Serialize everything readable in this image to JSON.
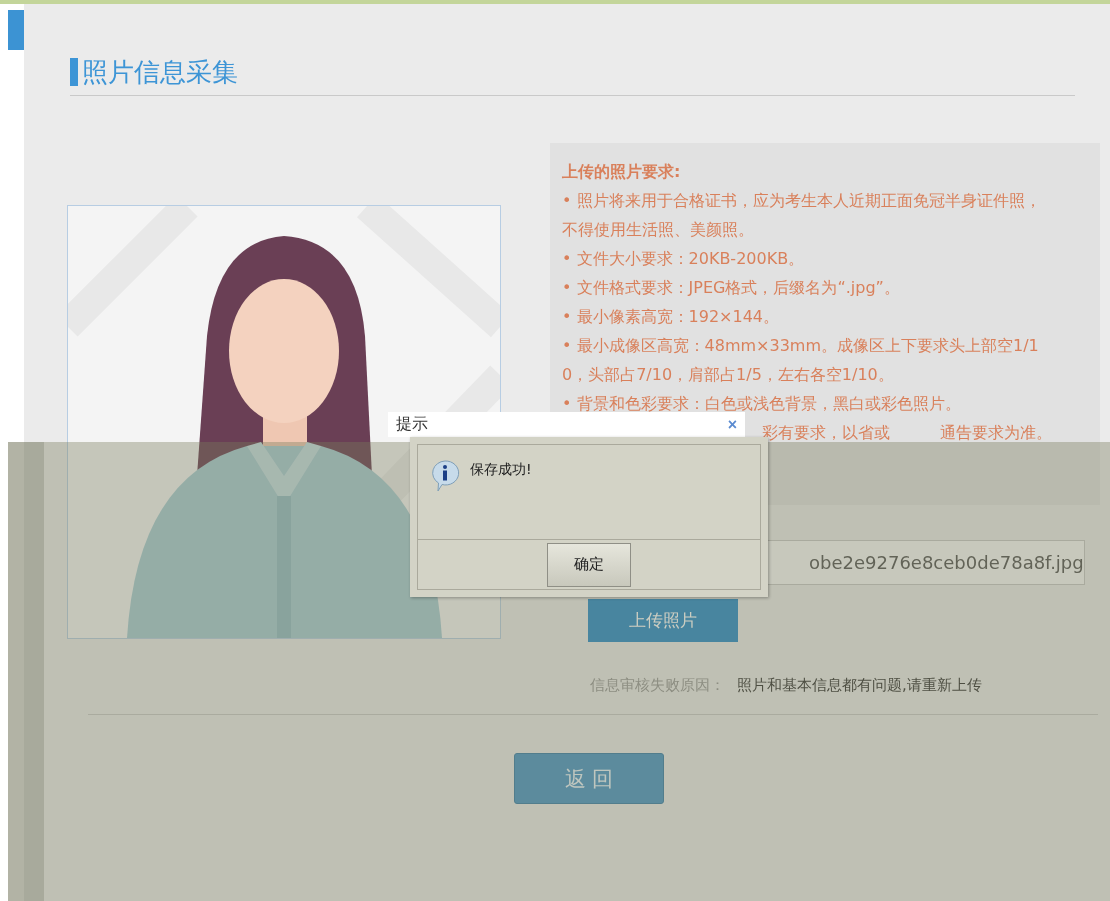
{
  "page": {
    "title": "照片信息采集"
  },
  "requirements": {
    "heading": "上传的照片要求:",
    "items": [
      "• 照片将来用于合格证书，应为考生本人近期正面免冠半身证件照，不得使用生活照、美颜照。",
      "• 文件大小要求：20KB-200KB。",
      "• 文件格式要求：JPEG格式，后缀名为“.jpg”。",
      "• 最小像素高宽：192×144。",
      "• 最小成像区高宽：48mm×33mm。成像区上下要求头上部空1/10，头部占7/10，肩部占1/5，左右各空1/10。",
      "• 背景和色彩要求：白色或浅色背景，黑白或彩色照片。"
    ],
    "partial_item": [
      "彩有要求，以省或",
      "通告要求为准。"
    ]
  },
  "file_field": {
    "value": "obe2e9276e8ceb0de78a8f.jpg"
  },
  "upload_button": "上传照片",
  "review": {
    "label": "信息审核失败原因：",
    "value": "照片和基本信息都有问题,请重新上传"
  },
  "back_button": "返 回",
  "dialog": {
    "title": "提示",
    "close": "×",
    "message": "保存成功!",
    "ok_button": "确定"
  }
}
